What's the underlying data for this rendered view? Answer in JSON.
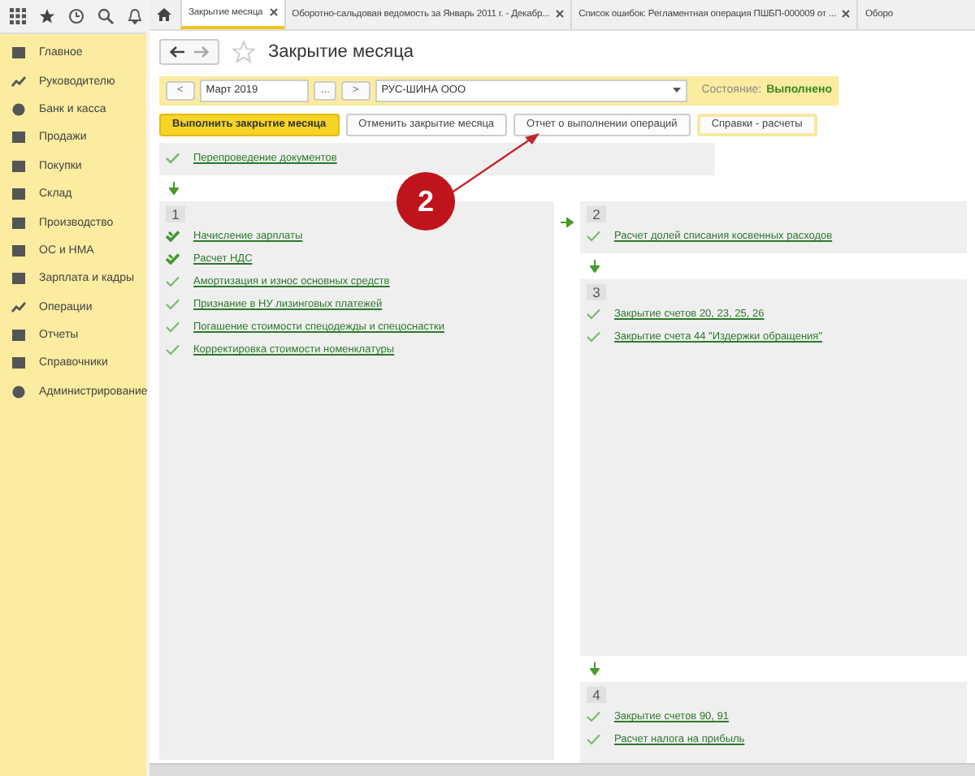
{
  "sidebar": {
    "items": [
      {
        "label": "Главное",
        "selected": false
      },
      {
        "label": "Руководителю",
        "selected": false
      },
      {
        "label": "Банк и касса",
        "selected": false
      },
      {
        "label": "Продажи",
        "selected": false
      },
      {
        "label": "Покупки",
        "selected": false
      },
      {
        "label": "Склад",
        "selected": false
      },
      {
        "label": "Производство",
        "selected": false
      },
      {
        "label": "ОС и НМА",
        "selected": false
      },
      {
        "label": "Зарплата и кадры",
        "selected": false
      },
      {
        "label": "Операции",
        "selected": false
      },
      {
        "label": "Отчеты",
        "selected": false
      },
      {
        "label": "Справочники",
        "selected": false
      },
      {
        "label": "Администрирование",
        "selected": false
      }
    ]
  },
  "tabs": [
    {
      "label": "Закрытие месяца",
      "selected": true,
      "closable": true
    },
    {
      "label": "Оборотно-сальдовая ведомость за Январь 2011 г. - Декабр...",
      "selected": false,
      "closable": true
    },
    {
      "label": "Список ошибок: Регламентная операция ПШБП-000009 от ...",
      "selected": false,
      "closable": true
    },
    {
      "label": "Оборо",
      "selected": false,
      "closable": false
    }
  ],
  "window": {
    "title": "Закрытие месяца"
  },
  "filter": {
    "period": "Март 2019",
    "prev": "<",
    "next": ">",
    "choose": "...",
    "organization": "РУС-ШИНА ООО",
    "status_label": "Состояние:",
    "status_value": "Выполнено"
  },
  "buttons": [
    {
      "label": "Выполнить закрытие месяца",
      "kind": "primary"
    },
    {
      "label": "Отменить закрытие месяца",
      "kind": "normal"
    },
    {
      "label": "Отчет о выполнении операций",
      "kind": "normal"
    },
    {
      "label": "Справки - расчеты",
      "kind": "outlined"
    }
  ],
  "pre_step": {
    "label": "Перепроведение документов",
    "done": false
  },
  "stages": [
    {
      "number": "1",
      "items": [
        {
          "label": "Начисление зарплаты",
          "done": true
        },
        {
          "label": "Расчет НДС",
          "done": true
        },
        {
          "label": "Амортизация и износ основных средств",
          "done": false
        },
        {
          "label": "Признание в НУ лизинговых платежей",
          "done": false
        },
        {
          "label": "Погашение стоимости спецодежды и спецоснастки",
          "done": false
        },
        {
          "label": "Корректировка стоимости номенклатуры",
          "done": false
        }
      ]
    },
    {
      "number": "2",
      "items": [
        {
          "label": "Расчет долей списания косвенных расходов",
          "done": false
        }
      ]
    },
    {
      "number": "3",
      "items": [
        {
          "label": "Закрытие счетов 20, 23, 25, 26",
          "done": false
        },
        {
          "label": "Закрытие счета 44 \"Издержки обращения\"",
          "done": false
        }
      ]
    },
    {
      "number": "4",
      "items": [
        {
          "label": "Закрытие счетов 90, 91",
          "done": false
        },
        {
          "label": "Расчет налога на прибыль",
          "done": false
        }
      ]
    }
  ],
  "callout": {
    "label": "2"
  }
}
